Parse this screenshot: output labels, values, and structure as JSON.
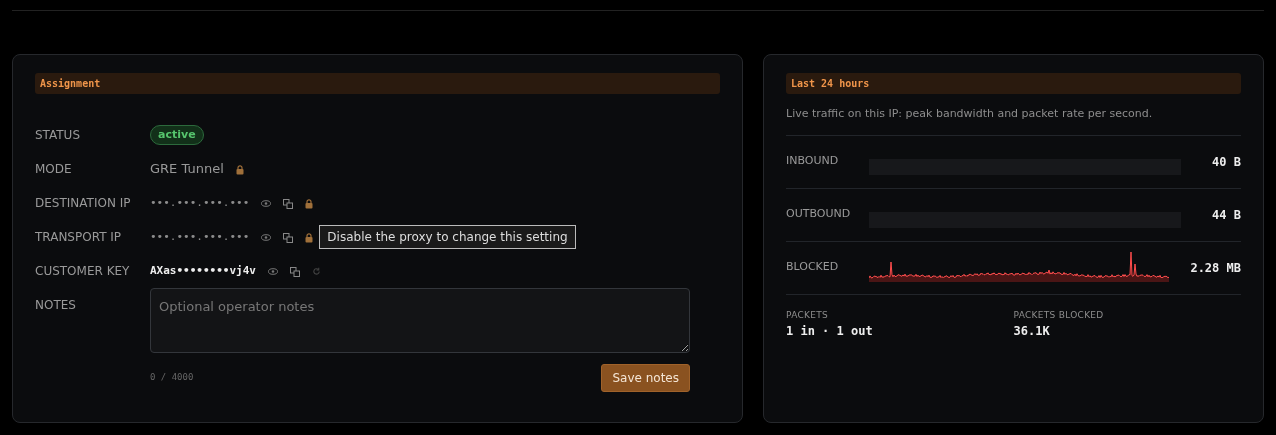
{
  "assignment": {
    "title": "Assignment",
    "fields": [
      {
        "label": "STATUS",
        "kind": "badge",
        "value": "active",
        "locked": false
      },
      {
        "label": "MODE",
        "kind": "text",
        "value": "GRE Tunnel",
        "locked": true
      },
      {
        "label": "DESTINATION IP",
        "kind": "secret",
        "value": "•••.•••.•••.•••",
        "locked": true
      },
      {
        "label": "TRANSPORT IP",
        "kind": "secret",
        "value": "•••.•••.•••.•••",
        "locked": true,
        "tooltip": "Disable the proxy to change this setting"
      },
      {
        "label": "CUSTOMER KEY",
        "kind": "key",
        "value": "AXas••••••••vj4v",
        "locked": false
      },
      {
        "label": "NOTES",
        "kind": "notes",
        "placeholder": "Optional operator notes",
        "counter": "0 / 4000",
        "button": "Save notes"
      }
    ]
  },
  "traffic": {
    "title": "Last 24 hours",
    "description": "Live traffic on this IP: peak bandwidth and packet rate per second.",
    "metrics": [
      {
        "label": "INBOUND",
        "kind": "bar",
        "reading": "40 B"
      },
      {
        "label": "OUTBOUND",
        "kind": "bar",
        "reading": "44 B"
      },
      {
        "label": "BLOCKED",
        "kind": "sparkline",
        "reading": "2.28 MB"
      }
    ],
    "stats": [
      {
        "label": "PACKETS",
        "value": "1 in · 1 out"
      },
      {
        "label": "PACKETS BLOCKED",
        "value": "36.1K"
      }
    ]
  }
}
